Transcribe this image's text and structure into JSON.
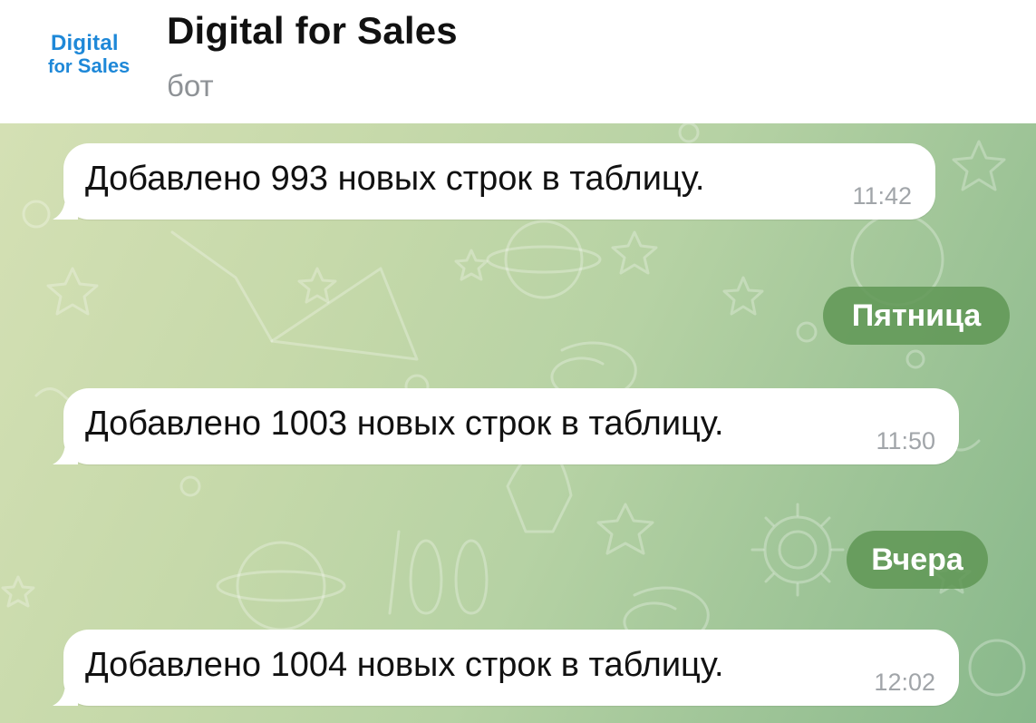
{
  "header": {
    "avatar": {
      "line1": "Digital",
      "line2_prefix": "for",
      "line2_main": "Sales"
    },
    "title": "Digital for Sales",
    "subtitle": "бот"
  },
  "messages": [
    {
      "text": "Добавлено 993 новых строк в таблицу.",
      "time": "11:42"
    },
    {
      "text": "Добавлено 1003 новых строк в таблицу.",
      "time": "11:50"
    },
    {
      "text": "Добавлено 1004 новых строк в таблицу.",
      "time": "12:02"
    }
  ],
  "date_separators": [
    {
      "label": "Пятница"
    },
    {
      "label": "Вчера"
    }
  ],
  "colors": {
    "avatar_text": "#1e88d8",
    "date_chip": "#5f9655",
    "time_text": "#a1a5a9"
  }
}
